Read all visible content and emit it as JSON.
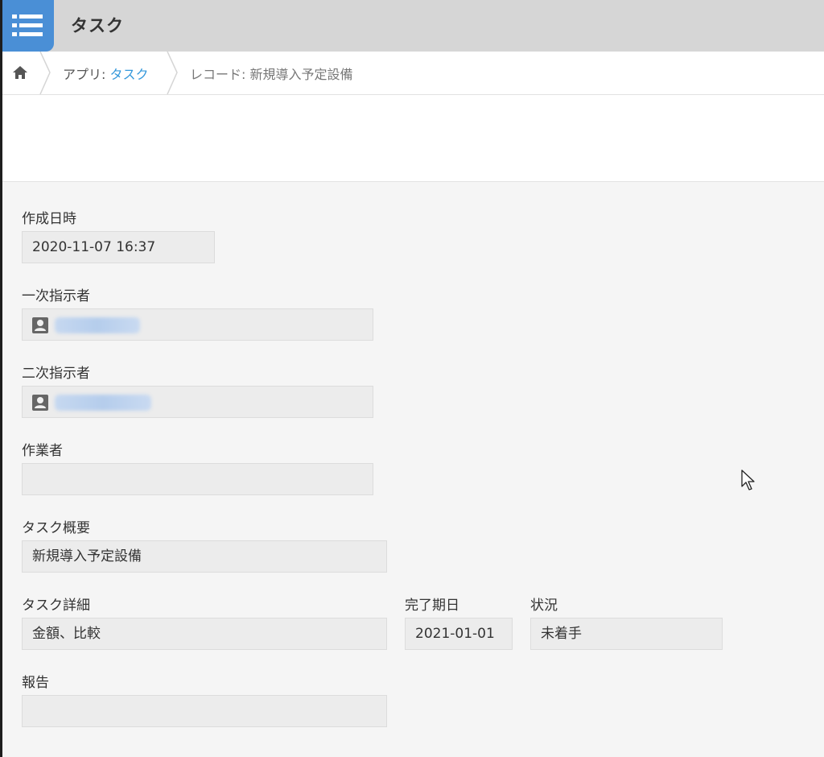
{
  "header": {
    "app_title": "タスク",
    "app_icon": "list-icon",
    "accent_color": "#4a8fd6"
  },
  "breadcrumb": {
    "home_icon": "home-icon",
    "app_prefix": "アプリ: ",
    "app_name": "タスク",
    "record_label": "レコード: 新規導入予定設備"
  },
  "fields": {
    "created_at": {
      "label": "作成日時",
      "value": "2020-11-07 16:37"
    },
    "primary_assigner": {
      "label": "一次指示者",
      "value": ""
    },
    "secondary_assigner": {
      "label": "二次指示者",
      "value": ""
    },
    "worker": {
      "label": "作業者",
      "value": ""
    },
    "task_summary": {
      "label": "タスク概要",
      "value": "新規導入予定設備"
    },
    "task_detail": {
      "label": "タスク詳細",
      "value": "金額、比較"
    },
    "due_date": {
      "label": "完了期日",
      "value": "2021-01-01"
    },
    "status": {
      "label": "状況",
      "value": "未着手"
    },
    "report": {
      "label": "報告",
      "value": ""
    }
  }
}
